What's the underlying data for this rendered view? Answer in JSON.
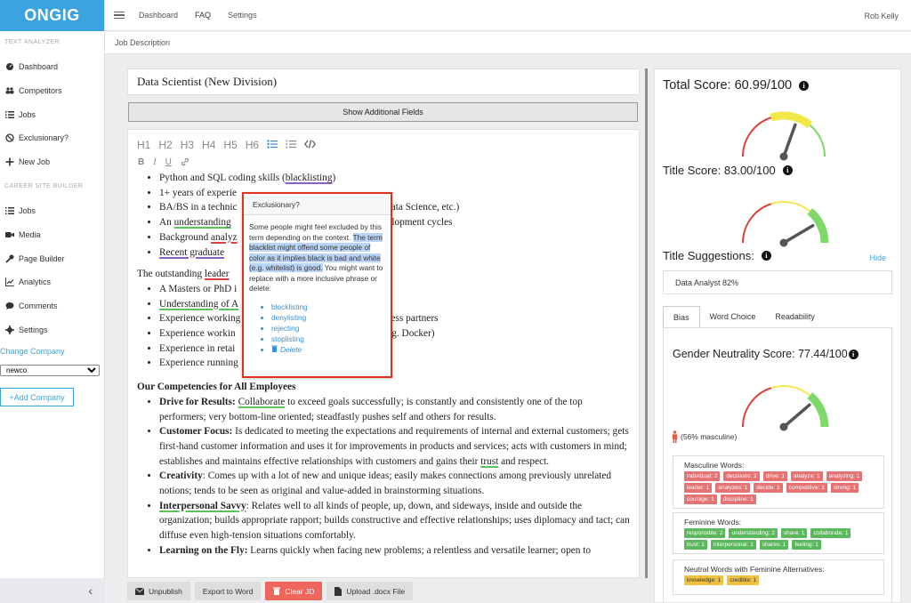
{
  "app": {
    "logo": "ONGIG"
  },
  "sidebar": {
    "text_analyzer_heading": "TEXT ANALYZER",
    "text_analyzer_items": [
      {
        "label": "Dashboard",
        "icon": "dashboard-icon"
      },
      {
        "label": "Competitors",
        "icon": "users-icon"
      },
      {
        "label": "Jobs",
        "icon": "list-icon"
      },
      {
        "label": "Exclusionary?",
        "icon": "ban-icon"
      },
      {
        "label": "New Job",
        "icon": "plus-icon"
      }
    ],
    "career_heading": "CAREER SITE BUILDER",
    "career_items": [
      {
        "label": "Jobs",
        "icon": "list-icon"
      },
      {
        "label": "Media",
        "icon": "video-icon"
      },
      {
        "label": "Page Builder",
        "icon": "wrench-icon"
      },
      {
        "label": "Analytics",
        "icon": "chart-line-icon"
      },
      {
        "label": "Comments",
        "icon": "comment-icon"
      },
      {
        "label": "Settings",
        "icon": "gear-icon"
      }
    ],
    "change_company": "Change Company",
    "company_value": "newco",
    "add_company": "+Add Company",
    "collapse": "‹"
  },
  "topbar": {
    "links": [
      "Dashboard",
      "FAQ",
      "Settings"
    ],
    "user": "Rob Kelly"
  },
  "subbar": {
    "label": "Job Description"
  },
  "editor": {
    "title": "Data Scientist (New Division)",
    "show_fields": "Show Additional Fields",
    "toolbar": [
      "H1",
      "H2",
      "H3",
      "H4",
      "H5",
      "H6"
    ],
    "list1": [
      {
        "pre": "Python and SQL coding skills (",
        "flag": "blacklisting",
        "post": ")"
      },
      {
        "pre": "1+ years of experie",
        "flag": "",
        "post": ""
      },
      {
        "pre": "BA/BS in a technic",
        "flag": "",
        "post": "cs, Data Science, etc.)"
      },
      {
        "pre": "An ",
        "flag": "understanding",
        "post": ""
      },
      {
        "pre": "Background ",
        "flag": "analyz",
        "post": ""
      },
      {
        "pre": "",
        "flag": "Recent graduate",
        "post": ""
      }
    ],
    "list1_right": {
      "3": "velopment cycles"
    },
    "para2_pre": "The outstanding ",
    "para2_flag": "leader",
    "list2": [
      "A Masters or PhD i",
      "Understanding of A",
      "Experience working",
      "Experience workin",
      "Experience in retai",
      "Experience running"
    ],
    "list2_right": {
      "2": "siness partners",
      "3": "(e.g. Docker)"
    },
    "competencies_heading": "Our Competencies for All Employees",
    "comp": [
      {
        "bold": "Drive for Results:",
        "flag": "Collaborate",
        "text": " to exceed goals successfully; is constantly and consistently one of the top performers; very bottom-line oriented; steadfastly pushes self and others for results."
      },
      {
        "bold": "Customer Focus:",
        "flag": "",
        "text": " Is dedicated to meeting the expectations and requirements of internal and external customers; gets first-hand customer information and uses it for improvements in products and services; acts with customers in mind; establishes and maintains effective relationships with customers and gains their ",
        "flag2": "trust",
        "text2": " and respect."
      },
      {
        "bold": "Creativity",
        "flag": "",
        "text": ": Comes up with a lot of new and unique ideas; easily makes connections among previously unrelated notions; tends to be seen as original and value-added in brainstorming situations."
      },
      {
        "bold": "Interpersonal Savvy",
        "flag": "",
        "text": ": Relates well to all kinds of people, up, down, and sideways, inside and outside the organization; builds appropriate rapport; builds constructive and effective relationships; uses diplomacy and tact; can diffuse even high-tension situations comfortably."
      },
      {
        "bold": "Learning on the Fly:",
        "flag": "",
        "text": " Learns quickly when facing new problems; a relentless and versatile learner; open to"
      }
    ]
  },
  "popup": {
    "title": "Exclusionary?",
    "text_before": "Some people might feel excluded by this term depending on the context. ",
    "text_highlight": "The term blacklist might offend some people of color as it implies black is bad and white (e.g. whitelist) is good.",
    "text_after": " You might want to replace with a more inclusive phrase or delete:",
    "options": [
      "blocklisting",
      "denylisting",
      "rejecting",
      "stoplisting"
    ],
    "delete_label": "Delete"
  },
  "bottom_buttons": [
    {
      "label": "Unpublish",
      "icon": "envelope-icon"
    },
    {
      "label": "Export to Word",
      "icon": ""
    },
    {
      "label": "Clear JD",
      "icon": "trash-icon"
    },
    {
      "label": "Upload .docx File",
      "icon": "file-icon"
    }
  ],
  "scores": {
    "total_label": "Total Score: 60.99/100",
    "total_value": 60.99,
    "title_label": "Title Score: 83.00/100",
    "title_value": 83.0,
    "suggestions_label": "Title Suggestions:",
    "hide": "Hide",
    "suggestion": "Data Analyst 82%",
    "tabs": [
      "Bias",
      "Word Choice",
      "Readability"
    ],
    "gender_label": "Gender Neutrality Score: 77.44/100",
    "gender_value": 77.44,
    "masculine_note": "(56% masculine)",
    "masculine_label": "Masculine Words:",
    "masculine_words": [
      "individual: 2",
      "decisions: 2",
      "drive: 1",
      "analyze: 1",
      "analyzing: 1",
      "leader: 1",
      "analyzes: 1",
      "decide: 1",
      "competitive: 1",
      "strong: 1",
      "courage: 1",
      "discipline: 1"
    ],
    "feminine_label": "Feminine Words:",
    "feminine_words": [
      "responsible: 2",
      "understanding: 2",
      "share: 1",
      "collaborate: 1",
      "trust: 1",
      "interpersonal: 1",
      "shares: 1",
      "feeling: 1"
    ],
    "neutral_label": "Neutral Words with Feminine Alternatives:",
    "neutral_words": [
      "knowledge: 1",
      "credible: 1"
    ]
  },
  "colors": {
    "brand": "#3aa3e0",
    "masculine": "#e57373",
    "feminine": "#5cb85c",
    "neutral": "#f0c040",
    "popup_border": "#e03020"
  }
}
